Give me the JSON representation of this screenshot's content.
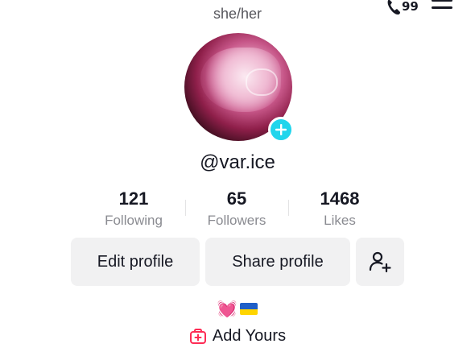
{
  "profile": {
    "pronouns": "she/her",
    "username": "@var.ice",
    "bio": "💓"
  },
  "header": {
    "inbox_count": "99"
  },
  "stats": {
    "following": {
      "value": "121",
      "label": "Following"
    },
    "followers": {
      "value": "65",
      "label": "Followers"
    },
    "likes": {
      "value": "1468",
      "label": "Likes"
    }
  },
  "actions": {
    "edit_label": "Edit profile",
    "share_label": "Share profile"
  },
  "add_yours": {
    "label": "Add Yours"
  },
  "colors": {
    "accent_cyan": "#20d5ec",
    "button_bg": "#f1f1f2",
    "pink": "#fe2c55",
    "flag_blue": "#1f5fc7",
    "flag_yellow": "#ffd500"
  },
  "icons": [
    "phone-icon",
    "menu-icon",
    "plus-icon",
    "add-user-icon",
    "heart-emoji",
    "ukraine-flag-icon",
    "add-yours-icon"
  ]
}
